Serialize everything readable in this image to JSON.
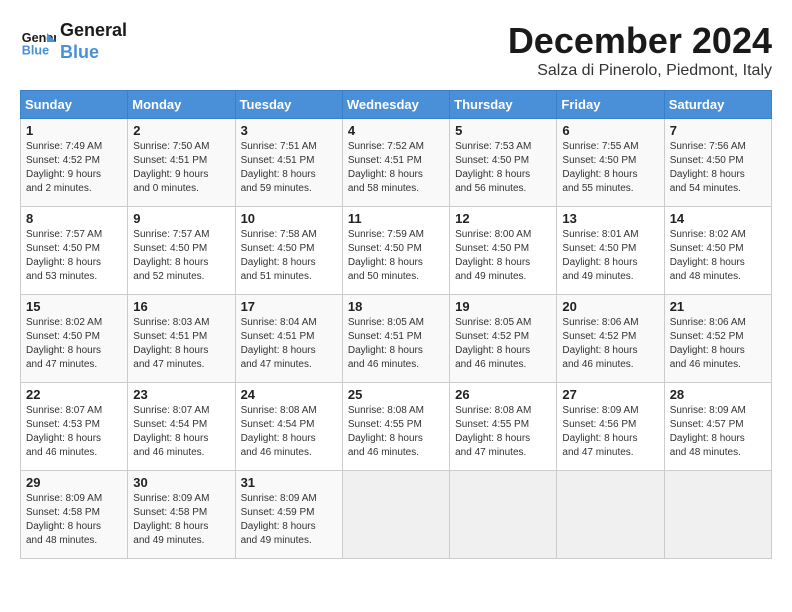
{
  "header": {
    "logo_line1": "General",
    "logo_line2": "Blue",
    "month": "December 2024",
    "location": "Salza di Pinerolo, Piedmont, Italy"
  },
  "days_of_week": [
    "Sunday",
    "Monday",
    "Tuesday",
    "Wednesday",
    "Thursday",
    "Friday",
    "Saturday"
  ],
  "weeks": [
    [
      {
        "day": "1",
        "sunrise": "7:49 AM",
        "sunset": "4:52 PM",
        "daylight": "9 hours and 2 minutes."
      },
      {
        "day": "2",
        "sunrise": "7:50 AM",
        "sunset": "4:51 PM",
        "daylight": "9 hours and 0 minutes."
      },
      {
        "day": "3",
        "sunrise": "7:51 AM",
        "sunset": "4:51 PM",
        "daylight": "8 hours and 59 minutes."
      },
      {
        "day": "4",
        "sunrise": "7:52 AM",
        "sunset": "4:51 PM",
        "daylight": "8 hours and 58 minutes."
      },
      {
        "day": "5",
        "sunrise": "7:53 AM",
        "sunset": "4:50 PM",
        "daylight": "8 hours and 56 minutes."
      },
      {
        "day": "6",
        "sunrise": "7:55 AM",
        "sunset": "4:50 PM",
        "daylight": "8 hours and 55 minutes."
      },
      {
        "day": "7",
        "sunrise": "7:56 AM",
        "sunset": "4:50 PM",
        "daylight": "8 hours and 54 minutes."
      }
    ],
    [
      {
        "day": "8",
        "sunrise": "7:57 AM",
        "sunset": "4:50 PM",
        "daylight": "8 hours and 53 minutes."
      },
      {
        "day": "9",
        "sunrise": "7:57 AM",
        "sunset": "4:50 PM",
        "daylight": "8 hours and 52 minutes."
      },
      {
        "day": "10",
        "sunrise": "7:58 AM",
        "sunset": "4:50 PM",
        "daylight": "8 hours and 51 minutes."
      },
      {
        "day": "11",
        "sunrise": "7:59 AM",
        "sunset": "4:50 PM",
        "daylight": "8 hours and 50 minutes."
      },
      {
        "day": "12",
        "sunrise": "8:00 AM",
        "sunset": "4:50 PM",
        "daylight": "8 hours and 49 minutes."
      },
      {
        "day": "13",
        "sunrise": "8:01 AM",
        "sunset": "4:50 PM",
        "daylight": "8 hours and 49 minutes."
      },
      {
        "day": "14",
        "sunrise": "8:02 AM",
        "sunset": "4:50 PM",
        "daylight": "8 hours and 48 minutes."
      }
    ],
    [
      {
        "day": "15",
        "sunrise": "8:02 AM",
        "sunset": "4:50 PM",
        "daylight": "8 hours and 47 minutes."
      },
      {
        "day": "16",
        "sunrise": "8:03 AM",
        "sunset": "4:51 PM",
        "daylight": "8 hours and 47 minutes."
      },
      {
        "day": "17",
        "sunrise": "8:04 AM",
        "sunset": "4:51 PM",
        "daylight": "8 hours and 47 minutes."
      },
      {
        "day": "18",
        "sunrise": "8:05 AM",
        "sunset": "4:51 PM",
        "daylight": "8 hours and 46 minutes."
      },
      {
        "day": "19",
        "sunrise": "8:05 AM",
        "sunset": "4:52 PM",
        "daylight": "8 hours and 46 minutes."
      },
      {
        "day": "20",
        "sunrise": "8:06 AM",
        "sunset": "4:52 PM",
        "daylight": "8 hours and 46 minutes."
      },
      {
        "day": "21",
        "sunrise": "8:06 AM",
        "sunset": "4:52 PM",
        "daylight": "8 hours and 46 minutes."
      }
    ],
    [
      {
        "day": "22",
        "sunrise": "8:07 AM",
        "sunset": "4:53 PM",
        "daylight": "8 hours and 46 minutes."
      },
      {
        "day": "23",
        "sunrise": "8:07 AM",
        "sunset": "4:54 PM",
        "daylight": "8 hours and 46 minutes."
      },
      {
        "day": "24",
        "sunrise": "8:08 AM",
        "sunset": "4:54 PM",
        "daylight": "8 hours and 46 minutes."
      },
      {
        "day": "25",
        "sunrise": "8:08 AM",
        "sunset": "4:55 PM",
        "daylight": "8 hours and 46 minutes."
      },
      {
        "day": "26",
        "sunrise": "8:08 AM",
        "sunset": "4:55 PM",
        "daylight": "8 hours and 47 minutes."
      },
      {
        "day": "27",
        "sunrise": "8:09 AM",
        "sunset": "4:56 PM",
        "daylight": "8 hours and 47 minutes."
      },
      {
        "day": "28",
        "sunrise": "8:09 AM",
        "sunset": "4:57 PM",
        "daylight": "8 hours and 48 minutes."
      }
    ],
    [
      {
        "day": "29",
        "sunrise": "8:09 AM",
        "sunset": "4:58 PM",
        "daylight": "8 hours and 48 minutes."
      },
      {
        "day": "30",
        "sunrise": "8:09 AM",
        "sunset": "4:58 PM",
        "daylight": "8 hours and 49 minutes."
      },
      {
        "day": "31",
        "sunrise": "8:09 AM",
        "sunset": "4:59 PM",
        "daylight": "8 hours and 49 minutes."
      },
      null,
      null,
      null,
      null
    ]
  ]
}
